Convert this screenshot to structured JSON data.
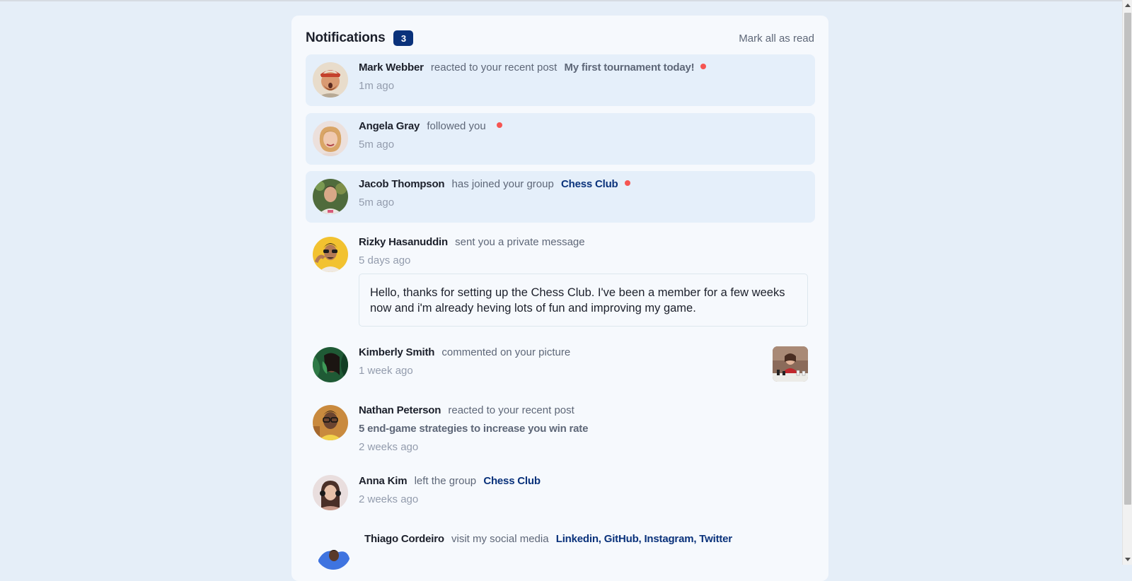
{
  "header": {
    "title": "Notifications",
    "unread_count": "3",
    "mark_all_label": "Mark all as read"
  },
  "notifications": [
    {
      "name": "Mark Webber",
      "action": "reacted to your recent post",
      "post": "My first tournament today!",
      "time": "1m ago",
      "unread": true
    },
    {
      "name": "Angela Gray",
      "action": "followed you",
      "time": "5m ago",
      "unread": true
    },
    {
      "name": "Jacob Thompson",
      "action": "has joined your group",
      "group": "Chess Club",
      "time": "5m ago",
      "unread": true
    },
    {
      "name": "Rizky Hasanuddin",
      "action": "sent you a private message",
      "time": "5 days ago",
      "message": "Hello, thanks for setting up the Chess Club. I've been a member for a few weeks now and i'm already heving lots of fun and improving my game.",
      "unread": false
    },
    {
      "name": "Kimberly Smith",
      "action": "commented on your picture",
      "time": "1 week ago",
      "unread": false
    },
    {
      "name": "Nathan Peterson",
      "action": "reacted to your recent post",
      "post": "5 end-game strategies to increase you win rate",
      "time": "2 weeks ago",
      "unread": false
    },
    {
      "name": "Anna Kim",
      "action": "left the group",
      "group": "Chess Club",
      "time": "2 weeks ago",
      "unread": false
    },
    {
      "name": "Thiago Cordeiro",
      "action": "visit my social media",
      "links": "Linkedin, GitHub, Instagram, Twitter",
      "unread": false
    }
  ],
  "colors": {
    "page_bg": "#e5eef8",
    "card_bg": "#f6f9fd",
    "unread_bg": "#e5effa",
    "badge": "#0a327b",
    "dot": "#f65552",
    "group_link": "#0a327b"
  }
}
